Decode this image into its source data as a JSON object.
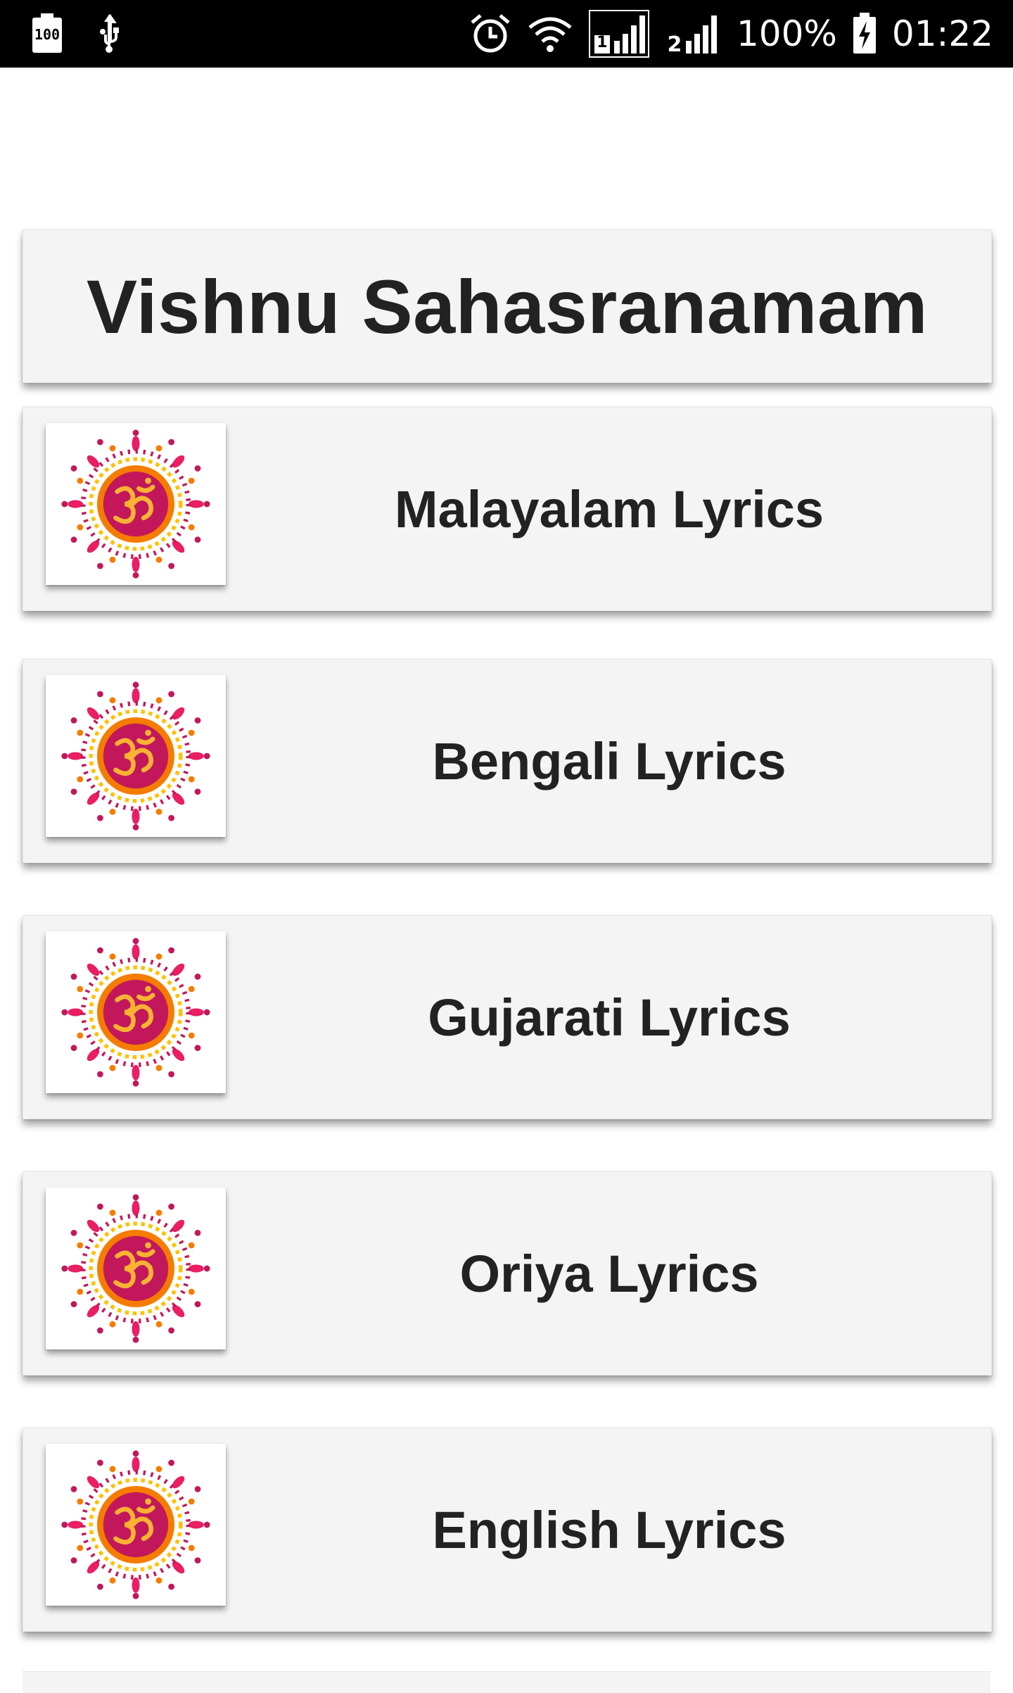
{
  "status_bar": {
    "battery_saver_label": "100",
    "battery_percent": "100%",
    "time": "01:22",
    "sim1_label": "1",
    "sim2_label": "2",
    "icons": [
      "battery-100-notification-icon",
      "usb-icon",
      "alarm-icon",
      "wifi-icon",
      "sim1-signal-icon",
      "sim2-signal-icon",
      "battery-charging-icon"
    ]
  },
  "header": {
    "title": "Vishnu Sahasranamam"
  },
  "list": {
    "items": [
      {
        "label": "Malayalam Lyrics",
        "icon": "om-mandala-icon"
      },
      {
        "label": "Bengali Lyrics",
        "icon": "om-mandala-icon"
      },
      {
        "label": "Gujarati Lyrics",
        "icon": "om-mandala-icon"
      },
      {
        "label": "Oriya Lyrics",
        "icon": "om-mandala-icon"
      },
      {
        "label": "English Lyrics",
        "icon": "om-mandala-icon"
      }
    ]
  },
  "colors": {
    "card_background": "#f4f4f4",
    "text": "#222222",
    "status_bar": "#000000",
    "mandala_crimson": "#c2185b",
    "mandala_orange": "#f57c00",
    "mandala_yellow": "#ffc107",
    "om_glyph": "#f9b233"
  }
}
